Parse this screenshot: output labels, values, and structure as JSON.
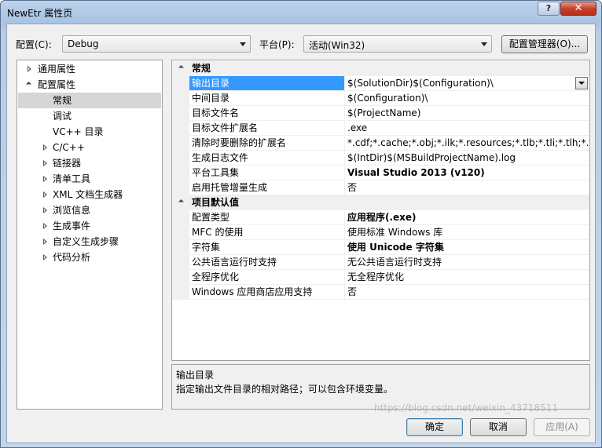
{
  "window": {
    "title": "NewEtr 属性页",
    "help_label": "?",
    "close_label": "✕"
  },
  "toolbar": {
    "config_label": "配置(C):",
    "config_value": "Debug",
    "platform_label": "平台(P):",
    "platform_value": "活动(Win32)",
    "config_manager_label": "配置管理器(O)..."
  },
  "tree": {
    "items": [
      {
        "label": "通用属性",
        "state": "closed"
      },
      {
        "label": "配置属性",
        "state": "open"
      },
      {
        "label": "常规",
        "state": "leaf",
        "selected": true
      },
      {
        "label": "调试",
        "state": "leaf"
      },
      {
        "label": "VC++ 目录",
        "state": "leaf"
      },
      {
        "label": "C/C++",
        "state": "closed"
      },
      {
        "label": "链接器",
        "state": "closed"
      },
      {
        "label": "清单工具",
        "state": "closed"
      },
      {
        "label": "XML 文档生成器",
        "state": "closed"
      },
      {
        "label": "浏览信息",
        "state": "closed"
      },
      {
        "label": "生成事件",
        "state": "closed"
      },
      {
        "label": "自定义生成步骤",
        "state": "closed"
      },
      {
        "label": "代码分析",
        "state": "closed"
      }
    ]
  },
  "grid": {
    "categories": [
      {
        "name": "常规",
        "rows": [
          {
            "name": "输出目录",
            "value": "$(SolutionDir)$(Configuration)\\"
          },
          {
            "name": "中间目录",
            "value": "$(Configuration)\\"
          },
          {
            "name": "目标文件名",
            "value": "$(ProjectName)"
          },
          {
            "name": "目标文件扩展名",
            "value": ".exe"
          },
          {
            "name": "清除时要删除的扩展名",
            "value": "*.cdf;*.cache;*.obj;*.ilk;*.resources;*.tlb;*.tli;*.tlh;*.tmp;*"
          },
          {
            "name": "生成日志文件",
            "value": "$(IntDir)$(MSBuildProjectName).log"
          },
          {
            "name": "平台工具集",
            "value": "Visual Studio 2013 (v120)"
          },
          {
            "name": "启用托管增量生成",
            "value": "否"
          }
        ]
      },
      {
        "name": "项目默认值",
        "rows": [
          {
            "name": "配置类型",
            "value": "应用程序(.exe)"
          },
          {
            "name": "MFC 的使用",
            "value": "使用标准 Windows 库"
          },
          {
            "name": "字符集",
            "value": "使用 Unicode 字符集"
          },
          {
            "name": "公共语言运行时支持",
            "value": "无公共语言运行时支持"
          },
          {
            "name": "全程序优化",
            "value": "无全程序优化"
          },
          {
            "name": "Windows 应用商店应用支持",
            "value": "否"
          }
        ]
      }
    ]
  },
  "description": {
    "title": "输出目录",
    "text": "指定输出文件目录的相对路径；可以包含环境变量。"
  },
  "buttons": {
    "ok": "确定",
    "cancel": "取消",
    "apply": "应用(A)"
  },
  "watermark": "https://blog.csdn.net/weixin_43718511"
}
